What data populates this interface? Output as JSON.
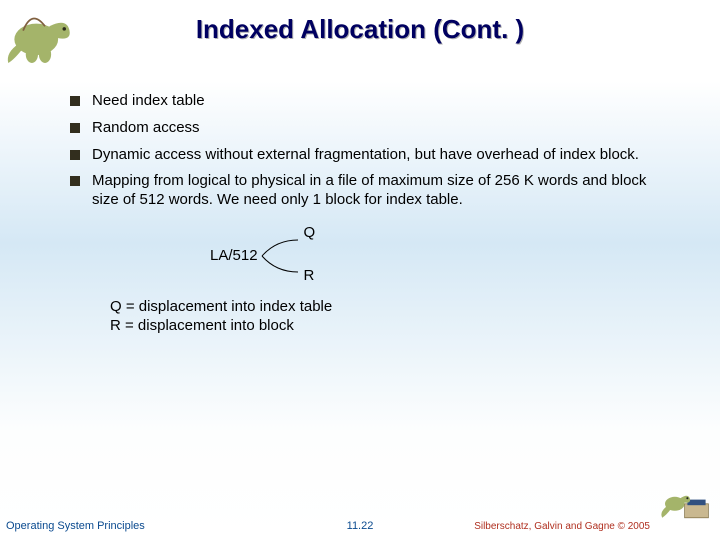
{
  "title": "Indexed Allocation (Cont. )",
  "bullets": [
    "Need index table",
    "Random access",
    "Dynamic access without external fragmentation, but have overhead of index block.",
    "Mapping from logical to physical in a file of maximum size of 256 K words and block size of 512 words.  We need only 1 block for index table."
  ],
  "diagram": {
    "lhs": "LA/512",
    "q": "Q",
    "r": "R"
  },
  "explain": {
    "line1": "Q = displacement into index table",
    "line2": "R = displacement into block"
  },
  "footer": {
    "left": "Operating System Principles",
    "center": "11.22",
    "right": "Silberschatz, Galvin and Gagne © 2005"
  }
}
